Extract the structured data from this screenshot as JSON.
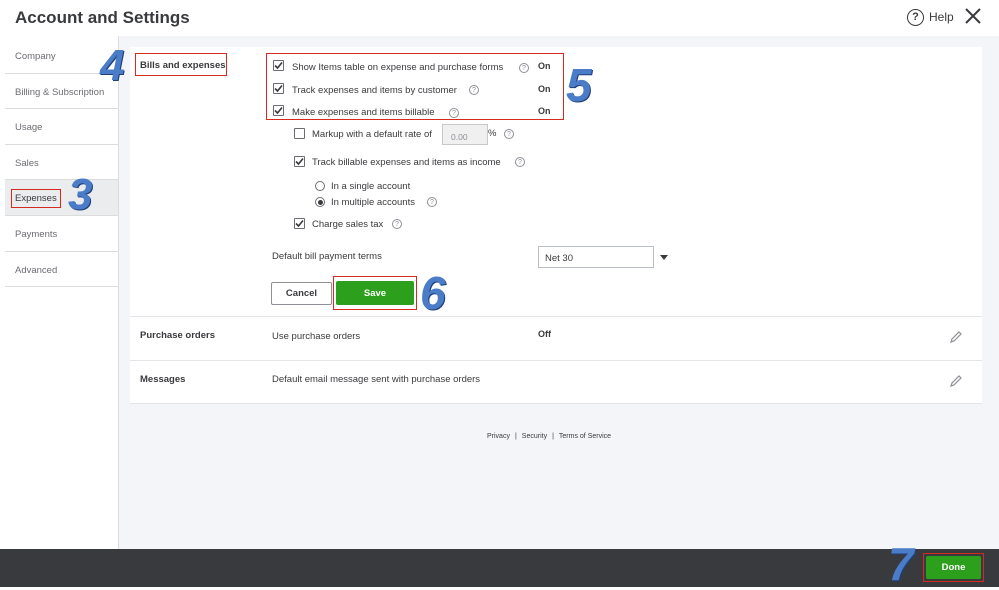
{
  "header": {
    "title": "Account and Settings",
    "help_icon": "question-circle-icon",
    "help_label": "Help",
    "close_icon": "close-icon"
  },
  "sidebar": {
    "items": [
      {
        "label": "Company"
      },
      {
        "label": "Billing & Subscription"
      },
      {
        "label": "Usage"
      },
      {
        "label": "Sales"
      },
      {
        "label": "Expenses"
      },
      {
        "label": "Payments"
      },
      {
        "label": "Advanced"
      }
    ],
    "active": "Expenses"
  },
  "bills": {
    "section_label": "Bills and expenses",
    "show_items": {
      "label": "Show Items table on expense and purchase forms",
      "checked": true,
      "status": "On"
    },
    "track_by_customer": {
      "label": "Track expenses and items by customer",
      "checked": true,
      "status": "On"
    },
    "billable": {
      "label": "Make expenses and items billable",
      "checked": true,
      "status": "On"
    },
    "markup": {
      "label": "Markup with a default rate of",
      "checked": false,
      "rate_value": "0.00",
      "percent": "%"
    },
    "track_income": {
      "label": "Track billable expenses and items as income",
      "checked": true
    },
    "single_account": {
      "label": "In a single account",
      "selected": false
    },
    "multiple_accounts": {
      "label": "In multiple accounts",
      "selected": true
    },
    "sales_tax": {
      "label": "Charge sales tax",
      "checked": true
    },
    "payment_terms": {
      "label": "Default bill payment terms",
      "value": "Net 30"
    },
    "cancel_label": "Cancel",
    "save_label": "Save"
  },
  "purchase_orders": {
    "section_label": "Purchase orders",
    "setting": "Use purchase orders",
    "status": "Off"
  },
  "messages": {
    "section_label": "Messages",
    "setting": "Default email message sent with purchase orders"
  },
  "footer": {
    "privacy": "Privacy",
    "separator": "|",
    "security": "Security",
    "terms": "Terms of Service"
  },
  "bottom": {
    "done_label": "Done"
  },
  "annotations": {
    "step3": "3",
    "step4": "4",
    "step5": "5",
    "step6": "6",
    "step7": "7"
  },
  "colors": {
    "accent_green": "#2ca01c",
    "highlight_red": "#d52b1e",
    "annotation_blue": "#4a7cc7",
    "bottom_bar": "#393a3d"
  }
}
